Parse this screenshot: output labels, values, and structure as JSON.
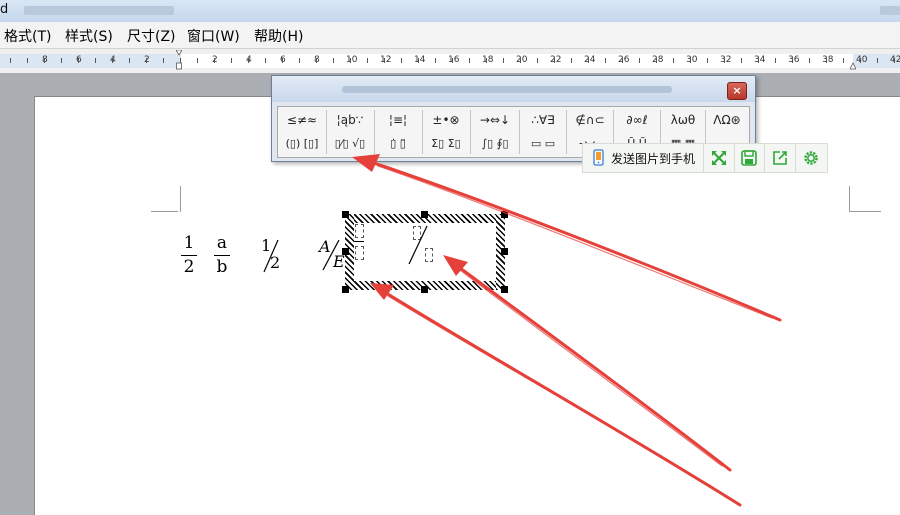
{
  "titlebar": {
    "icon_glyph": "d"
  },
  "menubar": {
    "items": [
      {
        "label": "格式(T)"
      },
      {
        "label": "样式(S)"
      },
      {
        "label": "尺寸(Z)"
      },
      {
        "label": "窗口(W)"
      },
      {
        "label": "帮助(H)"
      }
    ]
  },
  "ruler": {
    "left_numbers": [
      "8",
      "6",
      "4",
      "2"
    ],
    "right_numbers": [
      "2",
      "4",
      "6",
      "8",
      "10",
      "12",
      "14",
      "16",
      "18",
      "20",
      "22",
      "24",
      "26",
      "28",
      "30",
      "32",
      "34",
      "36",
      "38",
      "40",
      "42"
    ]
  },
  "palette": {
    "close_glyph": "×",
    "row1": [
      "≤≠≈",
      "¦ąb∵",
      "¦≡¦",
      "±•⊗",
      "→⇔↓",
      "∴∀∃",
      "∉∩⊂",
      "∂∞ℓ",
      "λωθ",
      "ΛΩ⊛"
    ],
    "row2": [
      "(▯) [▯]",
      "▯⁄▯ √▯",
      "▯̇ ▯̈",
      "Σ▯ Σ▯",
      "∫▯ ∮▯",
      "▭ ▭",
      "→ ←",
      "Ū Ũ",
      "▦ ▦"
    ]
  },
  "share_toolbar": {
    "label": "发送图片到手机"
  },
  "document": {
    "fractions": [
      {
        "numerator": "1",
        "denominator": "2"
      },
      {
        "numerator": "a",
        "denominator": "b"
      }
    ],
    "slash_fraction": {
      "numerator": "1",
      "denominator": "2"
    },
    "partial_slash_fraction": {
      "numerator": "A",
      "denominator": "E"
    }
  },
  "colors": {
    "arrow": "#e5403a",
    "share_icon": "#2fa83a",
    "palette_frame": "#6d7f96",
    "ruler_strip": "#dbe6f3"
  },
  "icons": [
    "close-icon",
    "phone-send-icon",
    "expand-icon",
    "save-icon",
    "share-out-icon",
    "settings-icon",
    "ruler-indent-icon"
  ]
}
